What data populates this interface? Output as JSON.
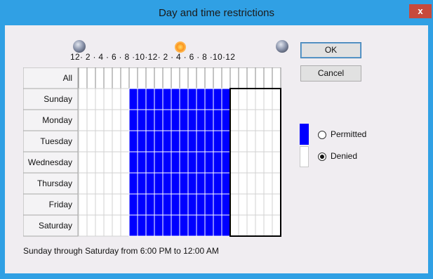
{
  "window": {
    "title": "Day and time restrictions",
    "close_label": "x"
  },
  "time_axis": {
    "ticks": "12· 2 · 4 · 6 · 8 ·10·12· 2 · 4 · 6 · 8 ·10·12",
    "icons": [
      "moon-icon",
      "sun-icon",
      "moon-icon"
    ]
  },
  "grid": {
    "all_label": "All",
    "days": [
      "Sunday",
      "Monday",
      "Tuesday",
      "Wednesday",
      "Thursday",
      "Friday",
      "Saturday"
    ],
    "hours_per_day": 24,
    "permitted_hours_start": 6,
    "permitted_hours_end": 18,
    "selection": {
      "days": "Sunday-Saturday",
      "from_hour": 18,
      "to_hour": 24
    }
  },
  "buttons": {
    "ok_label": "OK",
    "cancel_label": "Cancel"
  },
  "legend": {
    "permitted_label": "Permitted",
    "denied_label": "Denied",
    "selected_option": "Denied",
    "permitted_color": "#0000ff",
    "denied_color": "#ffffff"
  },
  "status": {
    "text": "Sunday through Saturday from 6:00 PM to 12:00 AM"
  },
  "colors": {
    "title_bar": "#30a0e4",
    "client_bg": "#f0edf1",
    "close_button": "#c74a3c"
  }
}
